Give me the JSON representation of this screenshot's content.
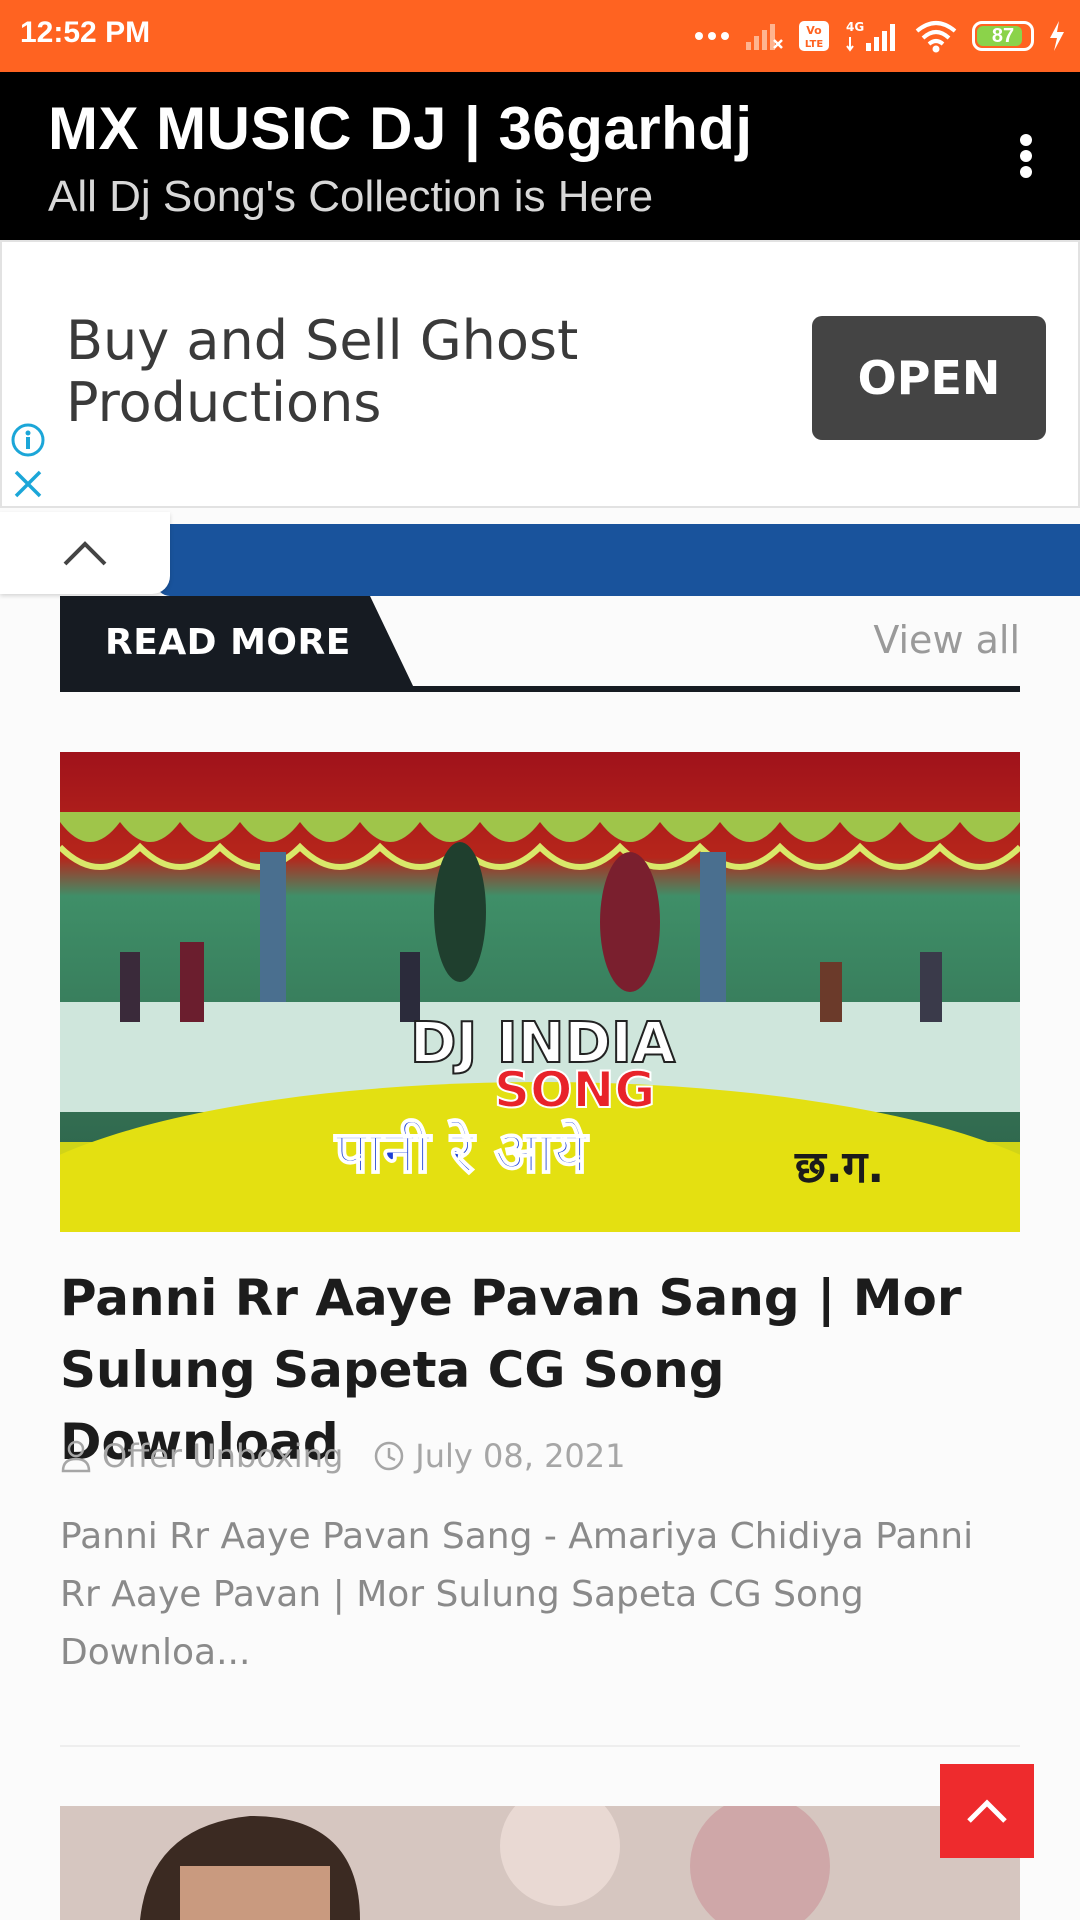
{
  "status_bar": {
    "time": "12:52 PM",
    "network_label": "4G",
    "volte_label": "Vo LTE",
    "battery_percent": "87",
    "battery_level": 0.87,
    "background": "#ff6321"
  },
  "app_bar": {
    "title": "MX MUSIC DJ | 36garhdj",
    "subtitle": "All Dj Song's Collection is Here",
    "menu_icon": "more-vert-icon"
  },
  "ad": {
    "headline": "Buy and Sell Ghost Productions",
    "button_label": "OPEN",
    "info_icon": "info-icon",
    "close_icon": "close-icon"
  },
  "section": {
    "title": "READ MORE",
    "view_all": "View all"
  },
  "post": {
    "image_text_1": "DJ INDIA",
    "image_text_2": "SONG",
    "image_text_3": "पानी रे आये",
    "image_text_4": "छ.ग.",
    "title": "Panni Rr Aaye Pavan Sang | Mor Sulung Sapeta CG Song Download",
    "author": "Offer Unboxing",
    "date": "July 08, 2021",
    "excerpt": "Panni Rr Aaye Pavan Sang - Amariya Chidiya Panni Rr Aaye Pavan | Mor Sulung Sapeta CG Song Downloa..."
  },
  "colors": {
    "accent_red": "#ee2b2d",
    "dark_label": "#161b22",
    "banner_blue": "#19539c"
  }
}
